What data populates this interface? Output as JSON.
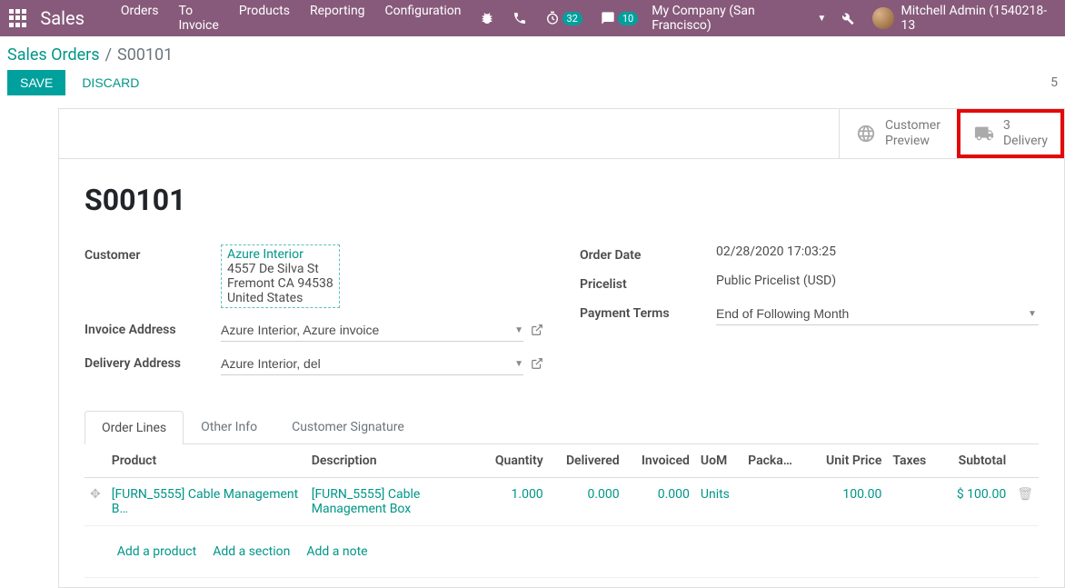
{
  "topbar": {
    "brand": "Sales",
    "nav": [
      "Orders",
      "To Invoice",
      "Products",
      "Reporting",
      "Configuration"
    ],
    "timer_badge": "32",
    "chat_badge": "10",
    "company": "My Company (San Francisco)",
    "user": "Mitchell Admin (1540218-13"
  },
  "breadcrumb": {
    "root": "Sales Orders",
    "current": "S00101"
  },
  "actions": {
    "save": "Save",
    "discard": "Discard",
    "count": "5"
  },
  "stat": {
    "preview_line1": "Customer",
    "preview_line2": "Preview",
    "delivery_count": "3",
    "delivery_label": "Delivery"
  },
  "order": {
    "name": "S00101"
  },
  "left": {
    "customer_label": "Customer",
    "customer_name": "Azure Interior",
    "customer_addr1": "4557 De Silva St",
    "customer_addr2": "Fremont CA 94538",
    "customer_country": "United States",
    "invoice_label": "Invoice Address",
    "invoice_value": "Azure Interior, Azure invoice",
    "delivery_label": "Delivery Address",
    "delivery_value": "Azure Interior, del"
  },
  "right": {
    "date_label": "Order Date",
    "date_value": "02/28/2020 17:03:25",
    "pricelist_label": "Pricelist",
    "pricelist_value": "Public Pricelist (USD)",
    "payment_label": "Payment Terms",
    "payment_value": "End of Following Month"
  },
  "tabs": [
    "Order Lines",
    "Other Info",
    "Customer Signature"
  ],
  "columns": {
    "product": "Product",
    "description": "Description",
    "quantity": "Quantity",
    "delivered": "Delivered",
    "invoiced": "Invoiced",
    "uom": "UoM",
    "package": "Packa…",
    "unit_price": "Unit Price",
    "taxes": "Taxes",
    "subtotal": "Subtotal"
  },
  "line": {
    "product": "[FURN_5555] Cable Management B…",
    "description": "[FURN_5555] Cable Management Box",
    "quantity": "1.000",
    "delivered": "0.000",
    "invoiced": "0.000",
    "uom": "Units",
    "unit_price": "100.00",
    "subtotal": "$ 100.00"
  },
  "add": {
    "product": "Add a product",
    "section": "Add a section",
    "note": "Add a note"
  }
}
